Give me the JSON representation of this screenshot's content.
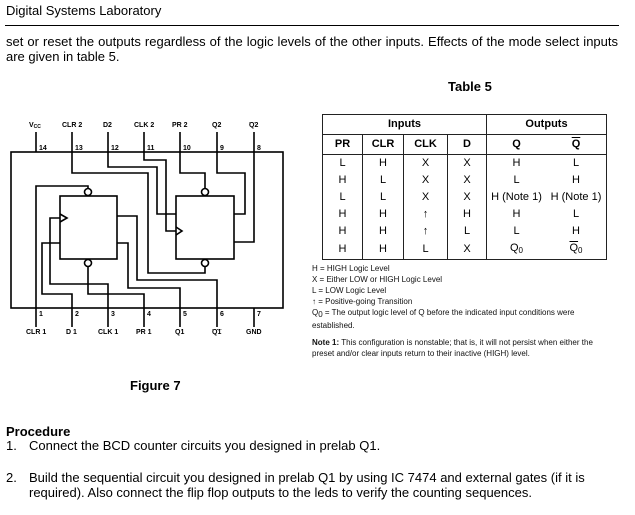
{
  "header": {
    "title": "Digital Systems Laboratory"
  },
  "intro_text": "set or reset the outputs regardless of the logic levels of the other inputs. Effects of the mode select inputs are given in table 5.",
  "table": {
    "caption": "Table 5",
    "group_headers": {
      "inputs": "Inputs",
      "outputs": "Outputs"
    },
    "columns": [
      "PR",
      "CLR",
      "CLK",
      "D",
      "Q",
      "Q"
    ],
    "rows": [
      [
        "L",
        "H",
        "X",
        "X",
        "H",
        "L"
      ],
      [
        "H",
        "L",
        "X",
        "X",
        "L",
        "H"
      ],
      [
        "L",
        "L",
        "X",
        "X",
        "H (Note 1)",
        "H (Note 1)"
      ],
      [
        "H",
        "H",
        "↑",
        "H",
        "H",
        "L"
      ],
      [
        "H",
        "H",
        "↑",
        "L",
        "L",
        "H"
      ],
      [
        "H",
        "H",
        "L",
        "X",
        "Q",
        "Q"
      ]
    ],
    "row6_subscript": "0",
    "legend": [
      "H = HIGH Logic Level",
      "X = Either LOW or HIGH Logic Level",
      "L = LOW Logic Level",
      "↑ = Positive-going Transition"
    ],
    "q0_legend": {
      "symbol": "Q",
      "subscript": "0",
      "text": " = The output logic level of Q before the indicated input conditions were established."
    },
    "note": {
      "label": "Note 1:",
      "text": " This configuration is nonstable; that is, it will not persist when either the preset and/or clear inputs return to their inactive (HIGH) level."
    }
  },
  "figure": {
    "caption": "Figure 7",
    "top_pins": [
      {
        "number": "14",
        "label": "VCC"
      },
      {
        "number": "13",
        "label": "CLR 2"
      },
      {
        "number": "12",
        "label": "D2"
      },
      {
        "number": "11",
        "label": "CLK 2"
      },
      {
        "number": "10",
        "label": "PR 2"
      },
      {
        "number": "9",
        "label": "Q2"
      },
      {
        "number": "8",
        "label": "Q2"
      }
    ],
    "bottom_pins": [
      {
        "number": "1",
        "label": "CLR 1"
      },
      {
        "number": "2",
        "label": "D 1"
      },
      {
        "number": "3",
        "label": "CLK 1"
      },
      {
        "number": "4",
        "label": "PR 1"
      },
      {
        "number": "5",
        "label": "Q1"
      },
      {
        "number": "6",
        "label": "Q1"
      },
      {
        "number": "7",
        "label": "GND"
      }
    ]
  },
  "procedure": {
    "title": "Procedure",
    "items": [
      {
        "num": "1.",
        "text": "Connect the BCD counter circuits you designed in prelab Q1."
      },
      {
        "num": "2.",
        "text": "Build the sequential circuit you designed in prelab Q1 by using IC 7474 and external gates (if it is required). Also connect the flip flop outputs to the leds to verify the counting sequences."
      }
    ]
  }
}
